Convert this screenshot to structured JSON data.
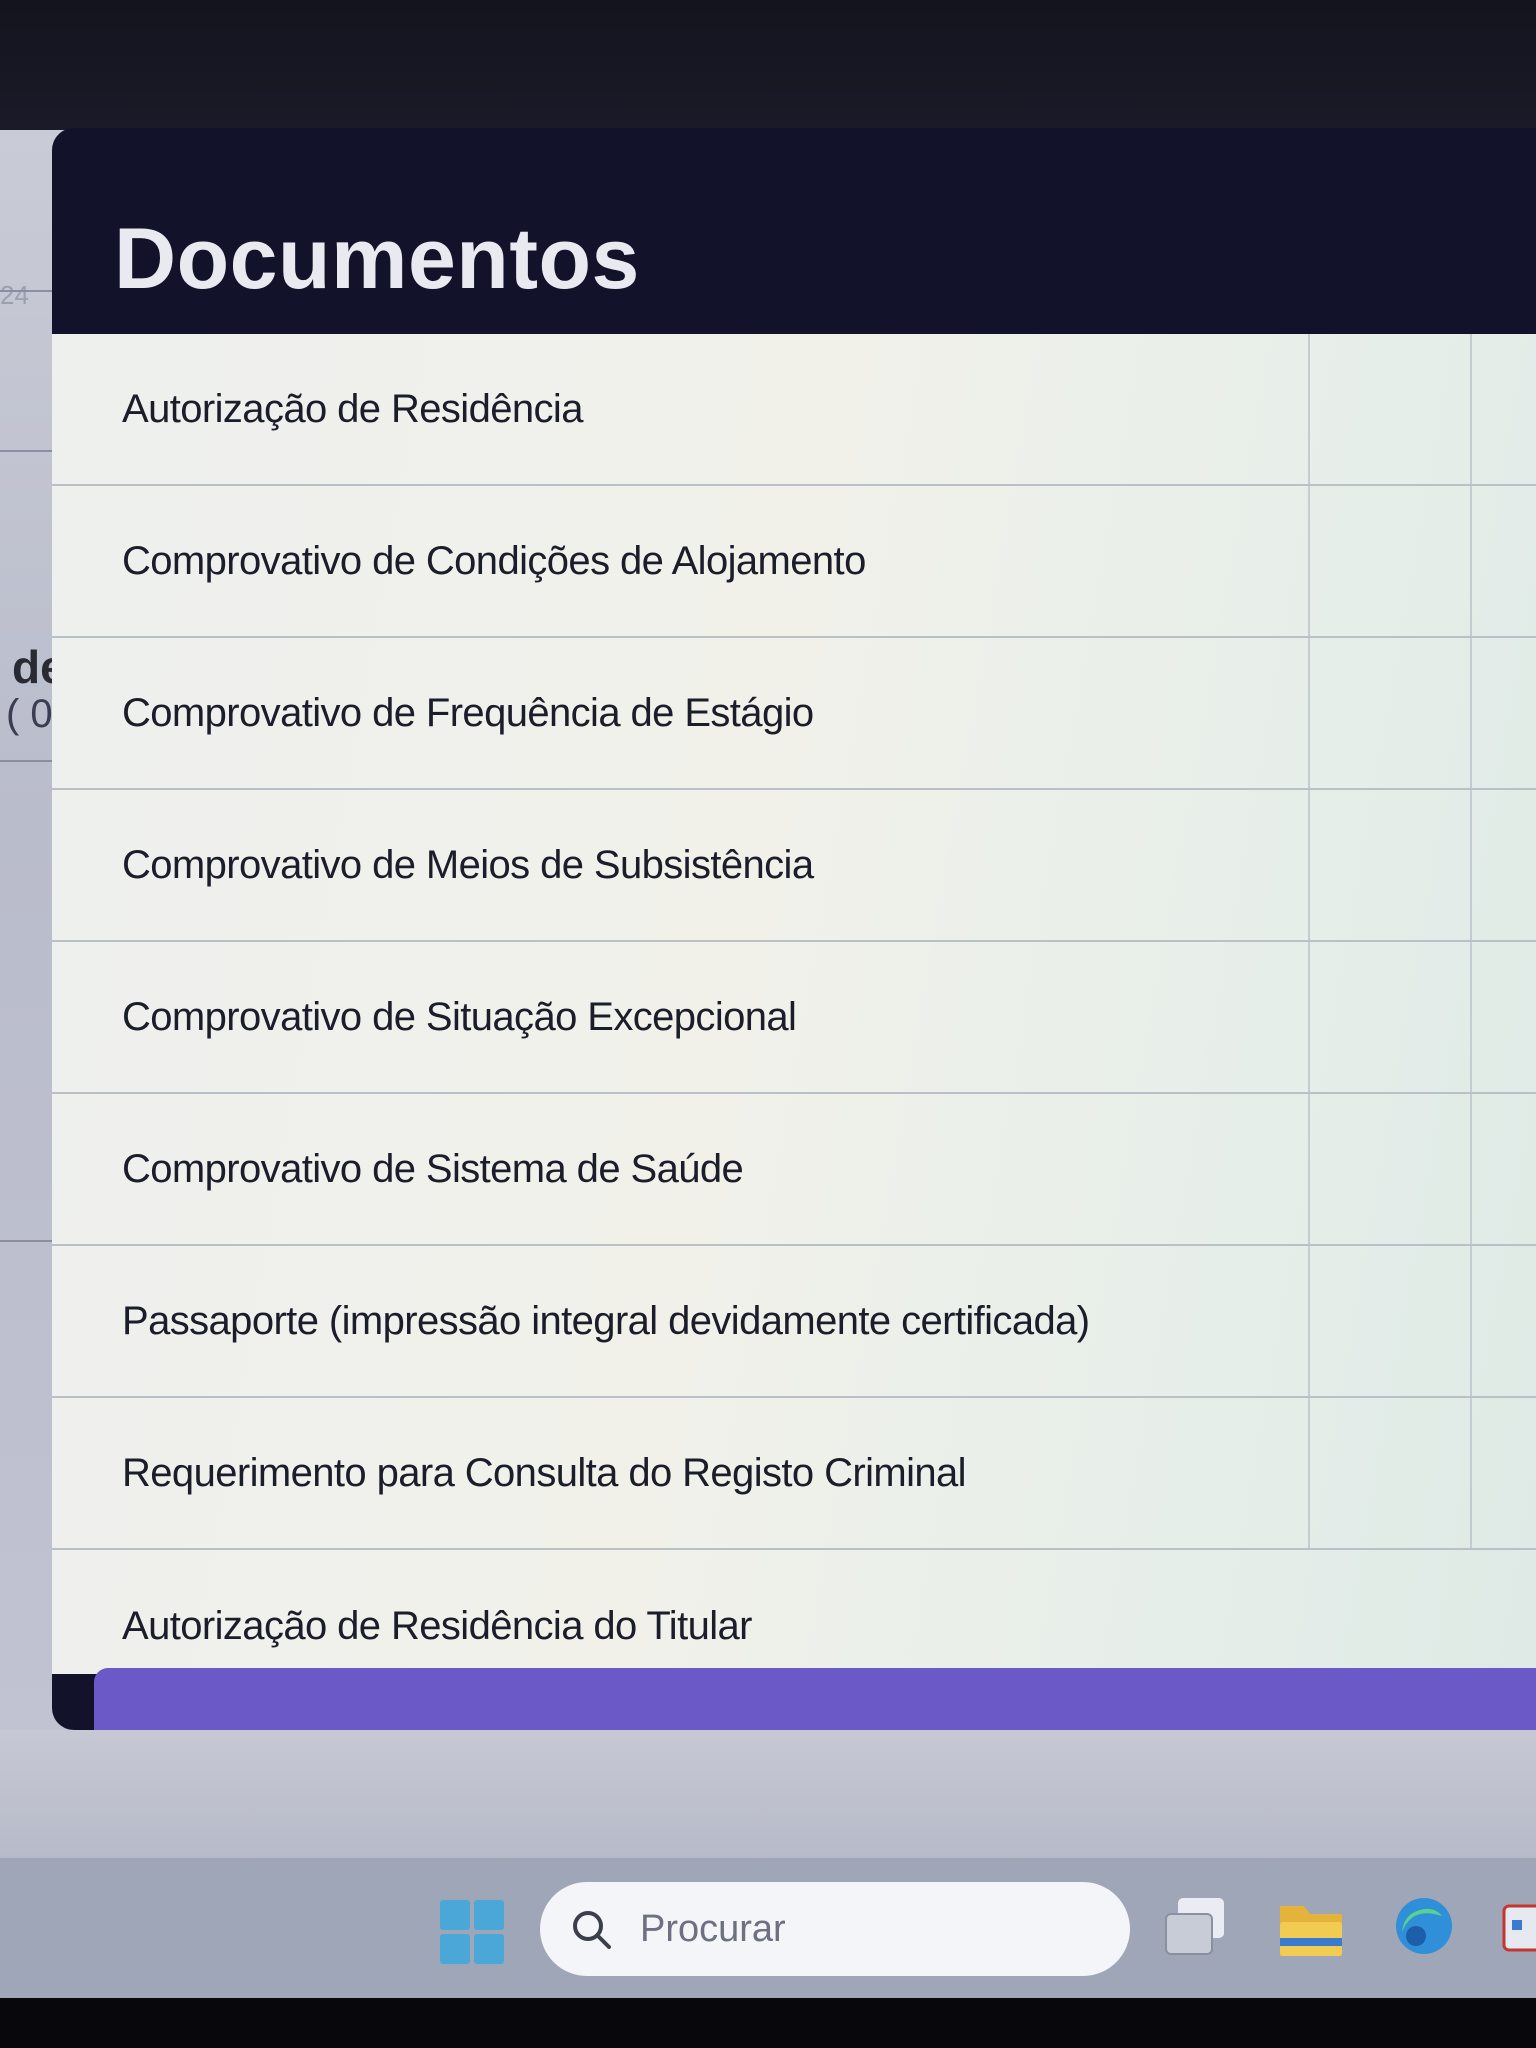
{
  "background": {
    "label_top": "24",
    "label_de": "de",
    "label_paren": "( 0"
  },
  "modal": {
    "title": "Documentos",
    "documents": [
      "Autorização de Residência",
      "Comprovativo de Condições de Alojamento",
      "Comprovativo de Frequência de Estágio",
      "Comprovativo de Meios de Subsistência",
      "Comprovativo de Situação Excepcional",
      "Comprovativo de Sistema de Saúde",
      "Passaporte (impressão integral devidamente certificada)",
      "Requerimento para Consulta do Registo Criminal",
      "Autorização de Residência do Titular"
    ],
    "action_color": "#6a59c6"
  },
  "taskbar": {
    "search_placeholder": "Procurar",
    "icons": [
      "windows-start-icon",
      "search-icon",
      "task-view-icon",
      "file-explorer-icon",
      "edge-browser-icon"
    ]
  }
}
